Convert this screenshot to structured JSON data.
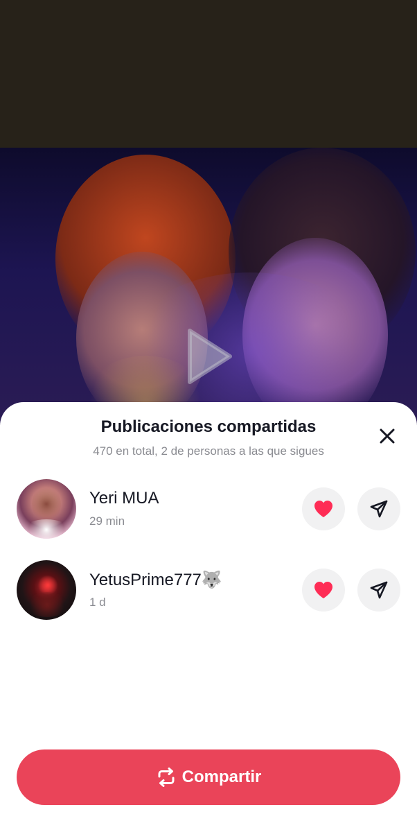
{
  "sheet": {
    "title": "Publicaciones compartidas",
    "subtitle": "470 en total, 2 de personas a las que sigues"
  },
  "users": [
    {
      "name": "Yeri MUA",
      "time": "29 min",
      "liked": true
    },
    {
      "name": "YetusPrime777🐺",
      "time": "1 d",
      "liked": true
    }
  ],
  "share_button": {
    "label": "Compartir"
  },
  "icons": {
    "play": "play-icon",
    "close": "close-icon",
    "like": "heart-icon",
    "send": "send-icon",
    "repost": "repost-icon"
  },
  "colors": {
    "accent": "#ea4459",
    "heart": "#fe2c55",
    "top_bar": "#272219",
    "text_primary": "#161823",
    "text_secondary": "#8a8b91"
  }
}
